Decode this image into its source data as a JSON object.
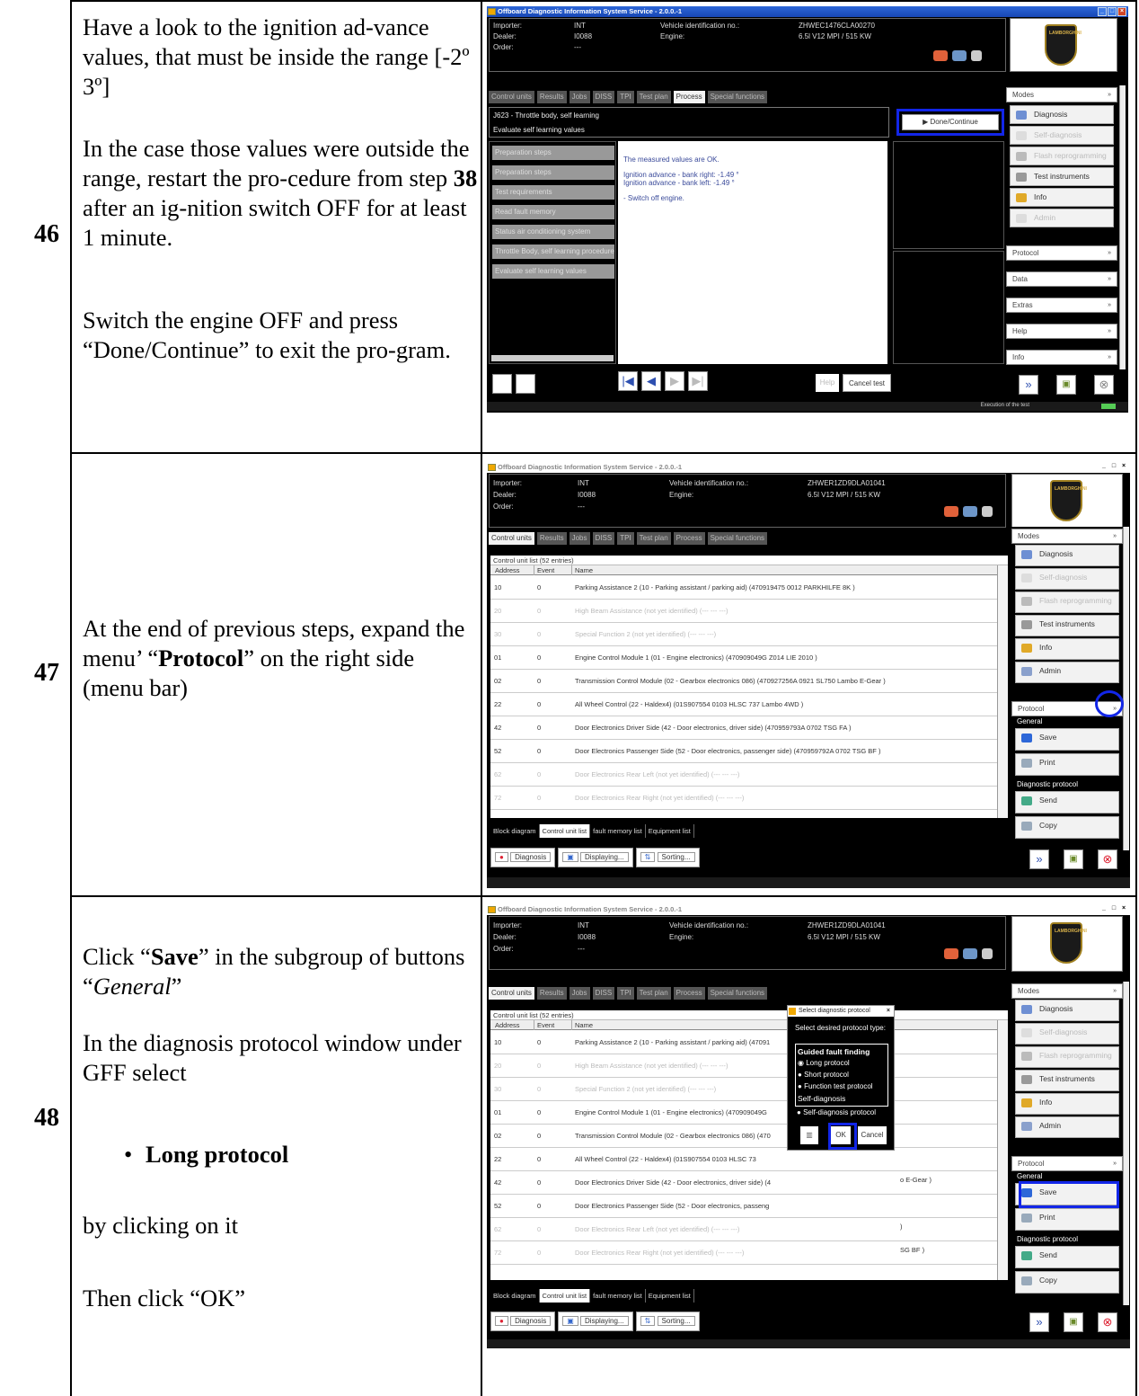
{
  "steps": [
    {
      "number": "46",
      "instructions": [
        "Have a look to the ignition advance values, that must be inside the range [-2º 3º]",
        "In the case those values were outside the range, restart the procedure from step 38 after an ignition switch OFF for at least 1 minute.",
        "Switch the engine OFF and press “Done/Continue” to exit the program."
      ],
      "instruction_parts": {
        "p1": "Have a look to the ignition ad-vance values, that must be inside the range [-2º 3º]",
        "p2a": "In the case those values were outside the range, restart the pro-cedure from step ",
        "p2b": "38",
        "p2c": " after an ig-nition switch OFF for at least 1 minute.",
        "p3": "Switch the engine OFF and press “Done/Continue” to exit the pro-gram."
      }
    },
    {
      "number": "47",
      "instruction_parts": {
        "p1a": "At the end of previous steps, expand the menu’ “",
        "p1b": "Protocol",
        "p1c": "” on the right side (menu bar)"
      }
    },
    {
      "number": "48",
      "instruction_parts": {
        "p1a": "Click “",
        "p1b": "Save",
        "p1c": "” in the subgroup of buttons “",
        "p1d": "General",
        "p1e": "”",
        "p2": "In the diagnosis protocol window under GFF select",
        "p3": "Long protocol",
        "p4": "by clicking on it",
        "p5": "Then click “OK”"
      }
    }
  ],
  "app": {
    "title1": "Offboard Diagnostic Information System Service - 2.0.0.-1",
    "title2": "Offboard Diagnostic Information System Service - 2.0.0.-1",
    "labels": {
      "importer": "Importer:",
      "dealer": "Dealer:",
      "order": "Order:",
      "vin": "Vehicle identification no.:",
      "engine": "Engine:"
    },
    "values": {
      "importer": "INT",
      "dealer": "I0088",
      "order": "---",
      "engine": "6.5l V12 MPI / 515 KW"
    },
    "vin_46": "ZHWEC1476CLA00270",
    "vin_47": "ZHWER1ZD9DLA01041",
    "logo_text": "LAMBORGHINI",
    "tabs": [
      "Control units",
      "Results",
      "Jobs",
      "DISS",
      "TPI",
      "Test plan",
      "Process",
      "Special functions"
    ],
    "modes": {
      "title": "Modes",
      "items": [
        "Diagnosis",
        "Self-diagnosis",
        "Flash reprogramming",
        "Test instruments",
        "Info",
        "Admin"
      ]
    },
    "sections": [
      "Protocol",
      "Data",
      "Extras",
      "Help",
      "Info"
    ],
    "protocol": {
      "title": "Protocol",
      "general": "General",
      "save": "Save",
      "print": "Print",
      "diag_protocol": "Diagnostic protocol",
      "send": "Send",
      "copy": "Copy"
    }
  },
  "process": {
    "title": "J623 - Throttle body, self learning",
    "subtitle": "Evaluate self learning values",
    "done_button": "Done/Continue",
    "steps": [
      "Preparation steps",
      "Preparation steps",
      "Test requirements",
      "Read fault memory",
      "Status air conditioning system",
      "Throttle Body, self learning procedure",
      "Evaluate self learning values"
    ],
    "message": [
      "The measured values are OK.",
      "Ignition advance - bank right: -1.49 °",
      "Ignition advance - bank left: -1.49 °",
      "- Switch off engine."
    ],
    "help": "Help",
    "cancel": "Cancel test",
    "status": "Execution of the test"
  },
  "cu_table": {
    "caption": "Control unit list (52 entries)",
    "headers": [
      "Address",
      "Event",
      "Name"
    ],
    "rows": [
      {
        "addr": "10",
        "event": "0",
        "name": "Parking Assistance 2 (10 - Parking assistant / parking aid) (470919475    0012   PARKHILFE 8K )",
        "grey": false
      },
      {
        "addr": "20",
        "event": "0",
        "name": "High Beam Assistance (not yet identified) (---  ---  ---)",
        "grey": true
      },
      {
        "addr": "30",
        "event": "0",
        "name": "Special Function 2 (not yet identified) (---  ---  ---)",
        "grey": true
      },
      {
        "addr": "01",
        "event": "0",
        "name": "Engine Control Module 1 (01 - Engine electronics) (470909049G   Z014   LIE 2010    )",
        "grey": false
      },
      {
        "addr": "02",
        "event": "0",
        "name": "Transmission Control Module (02 - Gearbox electronics 086) (470927256A    0921   SL750 Lambo E-Gear )",
        "grey": false
      },
      {
        "addr": "22",
        "event": "0",
        "name": "All Wheel Control (22 - Haldex4) (01S907554    0103   HLSC 737 Lambo 4WD )",
        "grey": false
      },
      {
        "addr": "42",
        "event": "0",
        "name": "Door Electronics Driver Side (42 - Door electronics, driver side) (470959793A   0702   TSG FA    )",
        "grey": false
      },
      {
        "addr": "52",
        "event": "0",
        "name": "Door Electronics Passenger Side (52 - Door electronics, passenger side) (470959792A   0702   TSG BF    )",
        "grey": false
      },
      {
        "addr": "62",
        "event": "0",
        "name": "Door Electronics Rear Left (not yet identified) (---  ---  ---)",
        "grey": true
      },
      {
        "addr": "72",
        "event": "0",
        "name": "Door Electronics Rear Right (not yet identified) (---  ---  ---)",
        "grey": true
      }
    ],
    "rows48": [
      "Parking Assistance 2 (10 - Parking assistant / parking aid) (47091",
      "High Beam Assistance (not yet identified) (---  ---  ---)",
      "Special Function 2 (not yet identified) (---  ---  ---)",
      "Engine Control Module 1 (01 - Engine electronics) (470909049G",
      "Transmission Control Module (02 - Gearbox electronics 086) (470",
      "All Wheel Control (22 - Haldex4) (01S907554    0103   HLSC 73",
      "Door Electronics Driver Side (42 - Door electronics, driver side) (4",
      "Door Electronics Passenger Side (52 - Door electronics, passeng",
      "Door Electronics Rear Left (not yet identified) (---  ---  ---)",
      "Door Electronics Rear Right (not yet identified) (---  ---  ---)"
    ],
    "right_tails": [
      "o E-Gear )",
      "  )",
      "SG BF    )"
    ],
    "bottom_tabs": [
      "Block diagram",
      "Control unit list",
      "fault memory list",
      "Equipment list"
    ],
    "bottom_buttons": [
      "Diagnosis",
      "Displaying...",
      "Sorting..."
    ]
  },
  "dialog": {
    "title": "Select diagnostic protocol",
    "prompt": "Select desired protocol type:",
    "gff": "Guided fault finding",
    "options": [
      "Long protocol",
      "Short protocol",
      "Function test protocol"
    ],
    "selfdiag": "Self-diagnosis",
    "selfdiag_option": "Self-diagnosis protocol",
    "ok": "OK",
    "cancel": "Cancel"
  },
  "colors": {
    "highlight": "#1226e8",
    "app_bg": "#000000",
    "title_blue": "#2d67d8"
  }
}
